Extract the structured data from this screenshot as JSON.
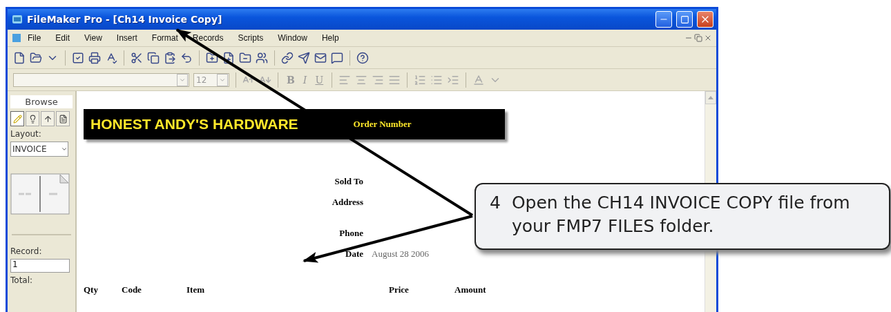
{
  "window": {
    "title": "FileMaker Pro - [Ch14 Invoice Copy]"
  },
  "menu_bar": {
    "items": [
      "File",
      "Edit",
      "View",
      "Insert",
      "Format",
      "Records",
      "Scripts",
      "Window",
      "Help"
    ]
  },
  "format_bar": {
    "font_size": "12",
    "style_buttons": [
      "B",
      "I",
      "U"
    ]
  },
  "status_area": {
    "mode": "Browse",
    "modes": [
      {
        "kind": "browse",
        "selected": true
      },
      {
        "kind": "find",
        "selected": false
      },
      {
        "kind": "layout",
        "selected": false
      },
      {
        "kind": "preview",
        "selected": false
      }
    ],
    "layout_label": "Layout:",
    "layout_value": "INVOICE",
    "record_label": "Record:",
    "record_value": "1",
    "total_label": "Total:"
  },
  "layout": {
    "company": "HONEST ANDY'S HARDWARE",
    "order_label": "Order Number",
    "fields": [
      {
        "label": "Sold To"
      },
      {
        "label": "Address"
      },
      {
        "label": "Phone"
      },
      {
        "label": "Date",
        "value": "August 28 2006"
      }
    ],
    "columns": [
      "Qty",
      "Code",
      "Item",
      "Price",
      "Amount"
    ]
  },
  "callout": {
    "step": "4",
    "text": "Open the CH14 INVOICE COPY file from your FMP7 FILES folder."
  }
}
